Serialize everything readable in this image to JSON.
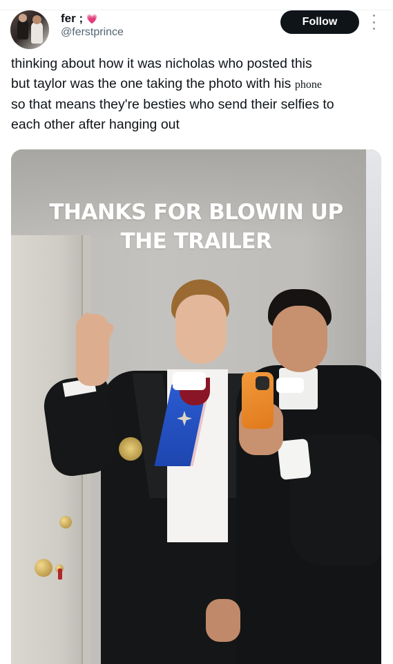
{
  "author": {
    "display_name": "fer ;",
    "handle": "@ferstprince",
    "emoji": "💗"
  },
  "actions": {
    "follow_label": "Follow"
  },
  "tweet": {
    "line1": "thinking about how it was nicholas who posted this",
    "line2_pre": "but taylor was the one taking the photo with his ",
    "line2_serif": "phone",
    "line3": "so that means they're besties who send their selfies to",
    "line4": "each other after hanging out"
  },
  "media": {
    "caption_line1": "THANKS FOR BLOWIN UP",
    "caption_line2": "THE TRAILER"
  },
  "colors": {
    "follow_bg": "#0f1419",
    "text": "#0f1419",
    "muted": "#536471",
    "heart": "#ff4f8b",
    "phone_case": "#f29a3c",
    "sash": "#2a5bd0"
  }
}
